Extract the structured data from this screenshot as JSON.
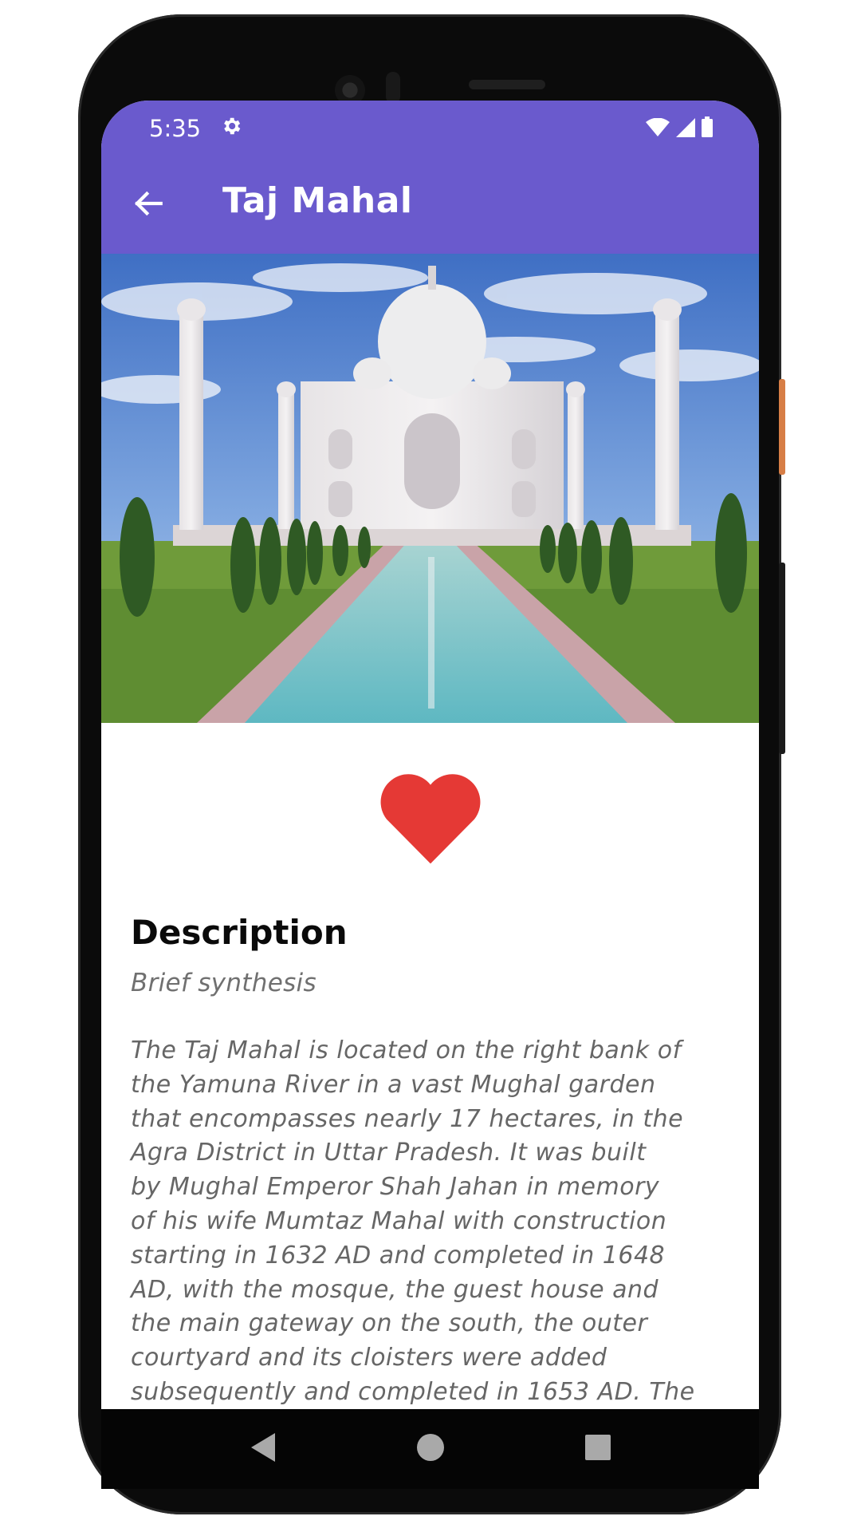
{
  "status_bar": {
    "time": "5:35",
    "icons": [
      "gear-icon",
      "wifi-icon",
      "cell-signal-icon",
      "battery-icon"
    ]
  },
  "app_bar": {
    "title": "Taj Mahal",
    "back_icon": "arrow-left-icon"
  },
  "hero_image": {
    "subject": "Taj Mahal"
  },
  "favorite": {
    "icon": "heart-icon",
    "state": "favorited"
  },
  "description": {
    "heading": "Description",
    "subtitle": "Brief synthesis",
    "lines": [
      "The Taj Mahal is located on the right bank of",
      "the Yamuna River in a vast Mughal garden",
      "that encompasses nearly 17 hectares, in the",
      "Agra District in Uttar Pradesh. It was built",
      "by Mughal Emperor Shah Jahan in memory",
      "of his wife Mumtaz Mahal with construction",
      "starting in 1632 AD and completed in 1648",
      "AD, with the mosque, the guest house and",
      "the main gateway on the south, the outer",
      "courtyard and its cloisters were added",
      "subsequently and completed in 1653 AD. The"
    ]
  },
  "nav_bar": {
    "buttons": [
      "back-triangle-icon",
      "home-circle-icon",
      "recents-square-icon"
    ]
  },
  "colors": {
    "primary": "#6a5acd",
    "heart": "#e53935",
    "heading_text": "#0a0a0a",
    "body_text": "#666666"
  }
}
